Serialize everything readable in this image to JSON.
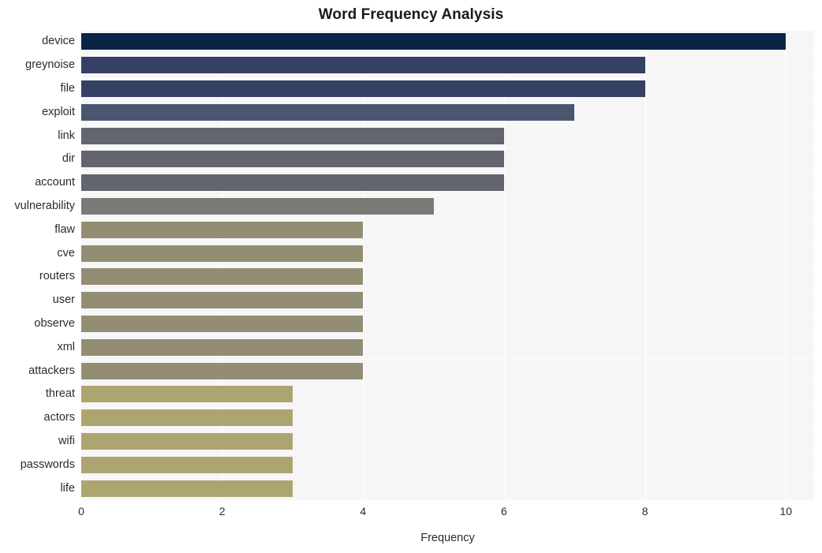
{
  "chart_data": {
    "type": "bar",
    "orientation": "horizontal",
    "title": "Word Frequency Analysis",
    "xlabel": "Frequency",
    "ylabel": "",
    "categories": [
      "device",
      "greynoise",
      "file",
      "exploit",
      "link",
      "dir",
      "account",
      "vulnerability",
      "flaw",
      "cve",
      "routers",
      "user",
      "observe",
      "xml",
      "attackers",
      "threat",
      "actors",
      "wifi",
      "passwords",
      "life"
    ],
    "values": [
      10,
      8,
      8,
      7,
      6,
      6,
      6,
      5,
      4,
      4,
      4,
      4,
      4,
      4,
      4,
      3,
      3,
      3,
      3,
      3
    ],
    "xlim": [
      0,
      10.4
    ],
    "xticks": [
      "0",
      "2",
      "4",
      "6",
      "8",
      "10"
    ],
    "xtick_values": [
      0,
      2,
      4,
      6,
      8,
      10
    ],
    "grid": true,
    "grid_axis": "x",
    "legend": false,
    "bar_colors": [
      "#0a2347",
      "#344164",
      "#344164",
      "#4c5570",
      "#62656e",
      "#62656e",
      "#62656e",
      "#7b7a77",
      "#938d74",
      "#938d74",
      "#938d74",
      "#938d74",
      "#938d74",
      "#938d74",
      "#938d74",
      "#ada570",
      "#ada570",
      "#ada570",
      "#ada570",
      "#ada570"
    ],
    "plot_background": "#f6f6f6",
    "gridline_color": "#ffffff",
    "figure_background": "#ffffff"
  }
}
